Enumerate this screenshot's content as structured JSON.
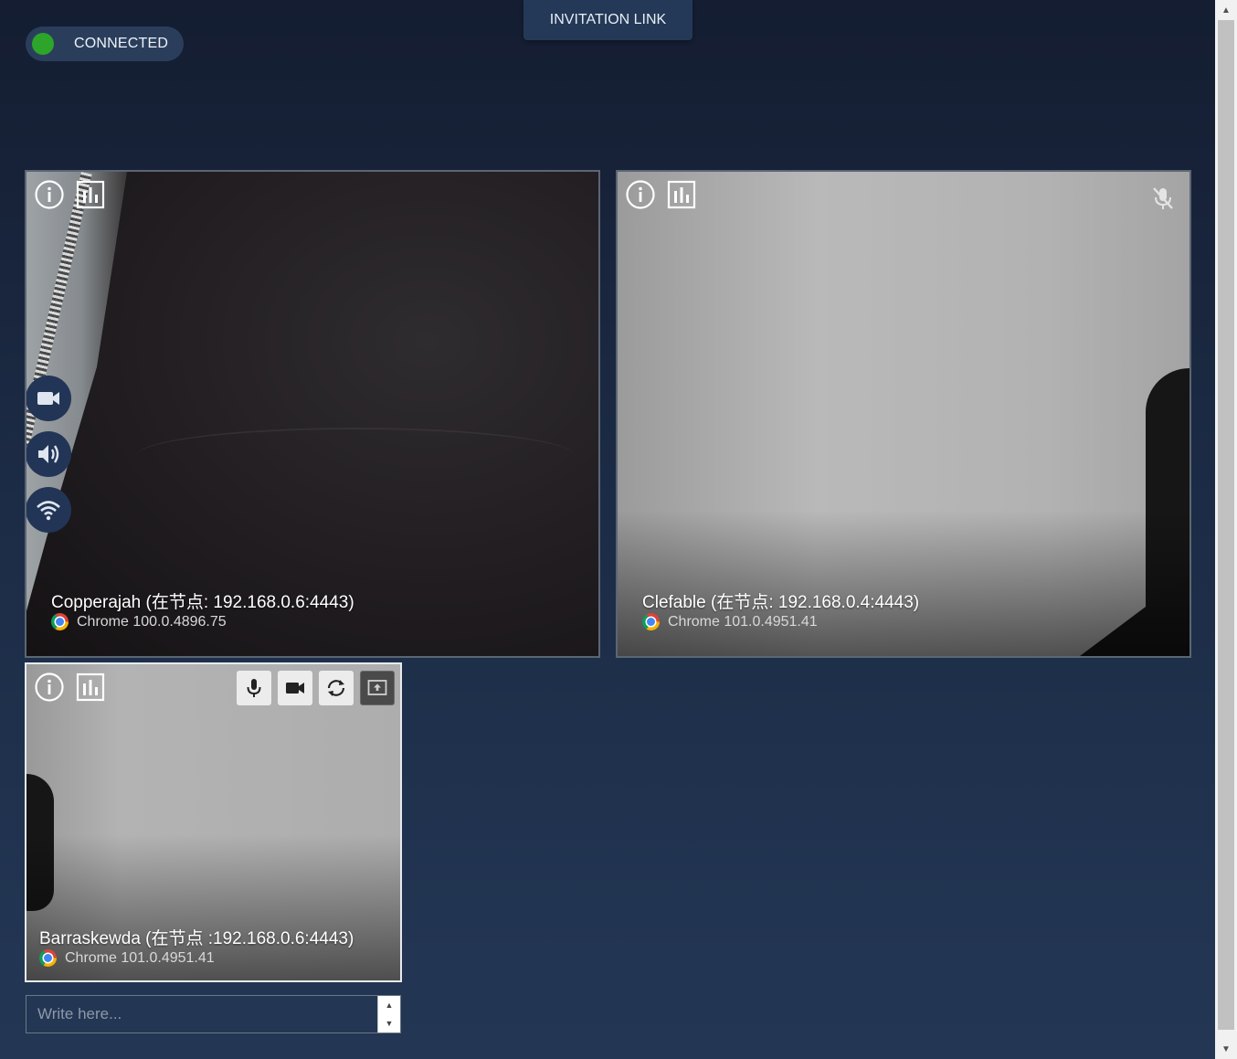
{
  "status": {
    "label": "CONNECTED",
    "color": "#2ca52a"
  },
  "invitation": {
    "label": "INVITATION LINK"
  },
  "tiles": [
    {
      "name": "Copperajah (在节点: 192.168.0.6:4443)",
      "browser": "Chrome 100.0.4896.75"
    },
    {
      "name": "Clefable (在节点: 192.168.0.4:4443)",
      "browser": "Chrome 101.0.4951.41"
    },
    {
      "name": "Barraskewda (在节点 :192.168.0.6:4443)",
      "browser": "Chrome 101.0.4951.41"
    }
  ],
  "chat": {
    "placeholder": "Write here..."
  },
  "icons": {
    "info": "info-icon",
    "stats": "stats-icon",
    "camera": "camera-icon",
    "speaker": "speaker-icon",
    "wifi": "wifi-icon",
    "mic": "microphone-icon",
    "mic_off": "microphone-off-icon",
    "refresh": "refresh-icon",
    "screen_share": "screen-share-icon",
    "chrome": "chrome-icon"
  }
}
